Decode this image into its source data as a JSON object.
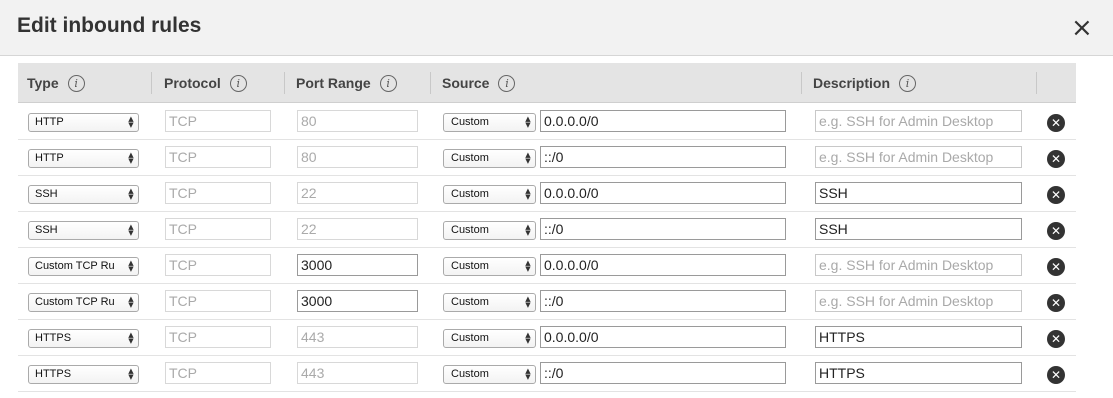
{
  "modal": {
    "title": "Edit inbound rules",
    "close_glyph": "×"
  },
  "columns": {
    "type": "Type",
    "protocol": "Protocol",
    "port_range": "Port Range",
    "source": "Source",
    "description": "Description",
    "info_glyph": "i"
  },
  "description_placeholder": "e.g. SSH for Admin Desktop",
  "icons": {
    "remove": "remove-circle-x",
    "info": "info-circle",
    "select_arrows": "up-down-chevron"
  },
  "rules": [
    {
      "type": "HTTP",
      "protocol": "TCP",
      "port": "80",
      "port_editable": false,
      "source_type": "Custom",
      "source": "0.0.0.0/0",
      "description": ""
    },
    {
      "type": "HTTP",
      "protocol": "TCP",
      "port": "80",
      "port_editable": false,
      "source_type": "Custom",
      "source": "::/0",
      "description": ""
    },
    {
      "type": "SSH",
      "protocol": "TCP",
      "port": "22",
      "port_editable": false,
      "source_type": "Custom",
      "source": "0.0.0.0/0",
      "description": "SSH"
    },
    {
      "type": "SSH",
      "protocol": "TCP",
      "port": "22",
      "port_editable": false,
      "source_type": "Custom",
      "source": "::/0",
      "description": "SSH"
    },
    {
      "type": "Custom TCP Ru",
      "protocol": "TCP",
      "port": "3000",
      "port_editable": true,
      "source_type": "Custom",
      "source": "0.0.0.0/0",
      "description": ""
    },
    {
      "type": "Custom TCP Ru",
      "protocol": "TCP",
      "port": "3000",
      "port_editable": true,
      "source_type": "Custom",
      "source": "::/0",
      "description": ""
    },
    {
      "type": "HTTPS",
      "protocol": "TCP",
      "port": "443",
      "port_editable": false,
      "source_type": "Custom",
      "source": "0.0.0.0/0",
      "description": "HTTPS"
    },
    {
      "type": "HTTPS",
      "protocol": "TCP",
      "port": "443",
      "port_editable": false,
      "source_type": "Custom",
      "source": "::/0",
      "description": "HTTPS"
    }
  ]
}
